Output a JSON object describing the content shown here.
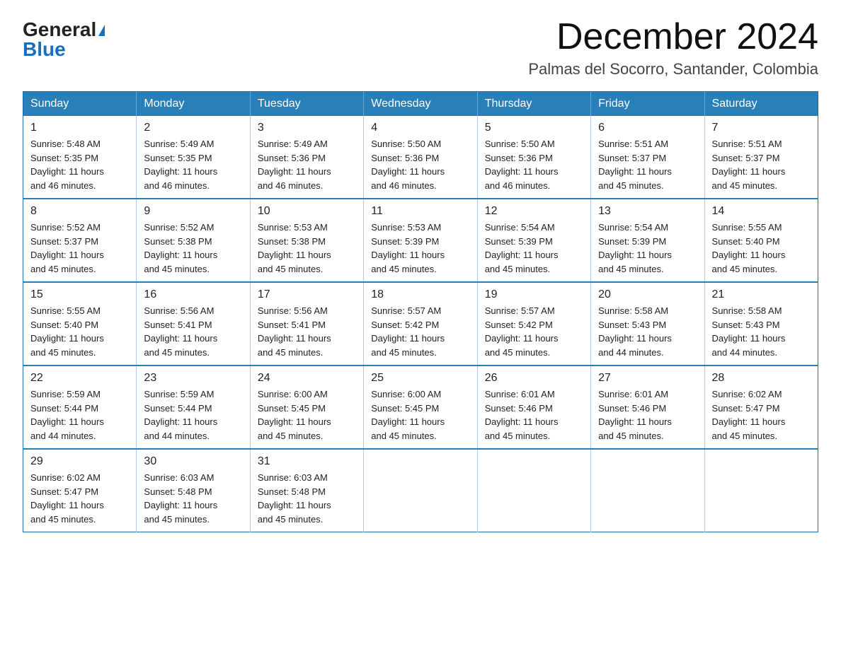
{
  "logo": {
    "general": "General",
    "blue": "Blue",
    "triangle": "▶"
  },
  "title": "December 2024",
  "location": "Palmas del Socorro, Santander, Colombia",
  "days_of_week": [
    "Sunday",
    "Monday",
    "Tuesday",
    "Wednesday",
    "Thursday",
    "Friday",
    "Saturday"
  ],
  "weeks": [
    [
      {
        "day": "1",
        "sunrise": "5:48 AM",
        "sunset": "5:35 PM",
        "daylight": "11 hours and 46 minutes."
      },
      {
        "day": "2",
        "sunrise": "5:49 AM",
        "sunset": "5:35 PM",
        "daylight": "11 hours and 46 minutes."
      },
      {
        "day": "3",
        "sunrise": "5:49 AM",
        "sunset": "5:36 PM",
        "daylight": "11 hours and 46 minutes."
      },
      {
        "day": "4",
        "sunrise": "5:50 AM",
        "sunset": "5:36 PM",
        "daylight": "11 hours and 46 minutes."
      },
      {
        "day": "5",
        "sunrise": "5:50 AM",
        "sunset": "5:36 PM",
        "daylight": "11 hours and 46 minutes."
      },
      {
        "day": "6",
        "sunrise": "5:51 AM",
        "sunset": "5:37 PM",
        "daylight": "11 hours and 45 minutes."
      },
      {
        "day": "7",
        "sunrise": "5:51 AM",
        "sunset": "5:37 PM",
        "daylight": "11 hours and 45 minutes."
      }
    ],
    [
      {
        "day": "8",
        "sunrise": "5:52 AM",
        "sunset": "5:37 PM",
        "daylight": "11 hours and 45 minutes."
      },
      {
        "day": "9",
        "sunrise": "5:52 AM",
        "sunset": "5:38 PM",
        "daylight": "11 hours and 45 minutes."
      },
      {
        "day": "10",
        "sunrise": "5:53 AM",
        "sunset": "5:38 PM",
        "daylight": "11 hours and 45 minutes."
      },
      {
        "day": "11",
        "sunrise": "5:53 AM",
        "sunset": "5:39 PM",
        "daylight": "11 hours and 45 minutes."
      },
      {
        "day": "12",
        "sunrise": "5:54 AM",
        "sunset": "5:39 PM",
        "daylight": "11 hours and 45 minutes."
      },
      {
        "day": "13",
        "sunrise": "5:54 AM",
        "sunset": "5:39 PM",
        "daylight": "11 hours and 45 minutes."
      },
      {
        "day": "14",
        "sunrise": "5:55 AM",
        "sunset": "5:40 PM",
        "daylight": "11 hours and 45 minutes."
      }
    ],
    [
      {
        "day": "15",
        "sunrise": "5:55 AM",
        "sunset": "5:40 PM",
        "daylight": "11 hours and 45 minutes."
      },
      {
        "day": "16",
        "sunrise": "5:56 AM",
        "sunset": "5:41 PM",
        "daylight": "11 hours and 45 minutes."
      },
      {
        "day": "17",
        "sunrise": "5:56 AM",
        "sunset": "5:41 PM",
        "daylight": "11 hours and 45 minutes."
      },
      {
        "day": "18",
        "sunrise": "5:57 AM",
        "sunset": "5:42 PM",
        "daylight": "11 hours and 45 minutes."
      },
      {
        "day": "19",
        "sunrise": "5:57 AM",
        "sunset": "5:42 PM",
        "daylight": "11 hours and 45 minutes."
      },
      {
        "day": "20",
        "sunrise": "5:58 AM",
        "sunset": "5:43 PM",
        "daylight": "11 hours and 44 minutes."
      },
      {
        "day": "21",
        "sunrise": "5:58 AM",
        "sunset": "5:43 PM",
        "daylight": "11 hours and 44 minutes."
      }
    ],
    [
      {
        "day": "22",
        "sunrise": "5:59 AM",
        "sunset": "5:44 PM",
        "daylight": "11 hours and 44 minutes."
      },
      {
        "day": "23",
        "sunrise": "5:59 AM",
        "sunset": "5:44 PM",
        "daylight": "11 hours and 44 minutes."
      },
      {
        "day": "24",
        "sunrise": "6:00 AM",
        "sunset": "5:45 PM",
        "daylight": "11 hours and 45 minutes."
      },
      {
        "day": "25",
        "sunrise": "6:00 AM",
        "sunset": "5:45 PM",
        "daylight": "11 hours and 45 minutes."
      },
      {
        "day": "26",
        "sunrise": "6:01 AM",
        "sunset": "5:46 PM",
        "daylight": "11 hours and 45 minutes."
      },
      {
        "day": "27",
        "sunrise": "6:01 AM",
        "sunset": "5:46 PM",
        "daylight": "11 hours and 45 minutes."
      },
      {
        "day": "28",
        "sunrise": "6:02 AM",
        "sunset": "5:47 PM",
        "daylight": "11 hours and 45 minutes."
      }
    ],
    [
      {
        "day": "29",
        "sunrise": "6:02 AM",
        "sunset": "5:47 PM",
        "daylight": "11 hours and 45 minutes."
      },
      {
        "day": "30",
        "sunrise": "6:03 AM",
        "sunset": "5:48 PM",
        "daylight": "11 hours and 45 minutes."
      },
      {
        "day": "31",
        "sunrise": "6:03 AM",
        "sunset": "5:48 PM",
        "daylight": "11 hours and 45 minutes."
      },
      null,
      null,
      null,
      null
    ]
  ]
}
